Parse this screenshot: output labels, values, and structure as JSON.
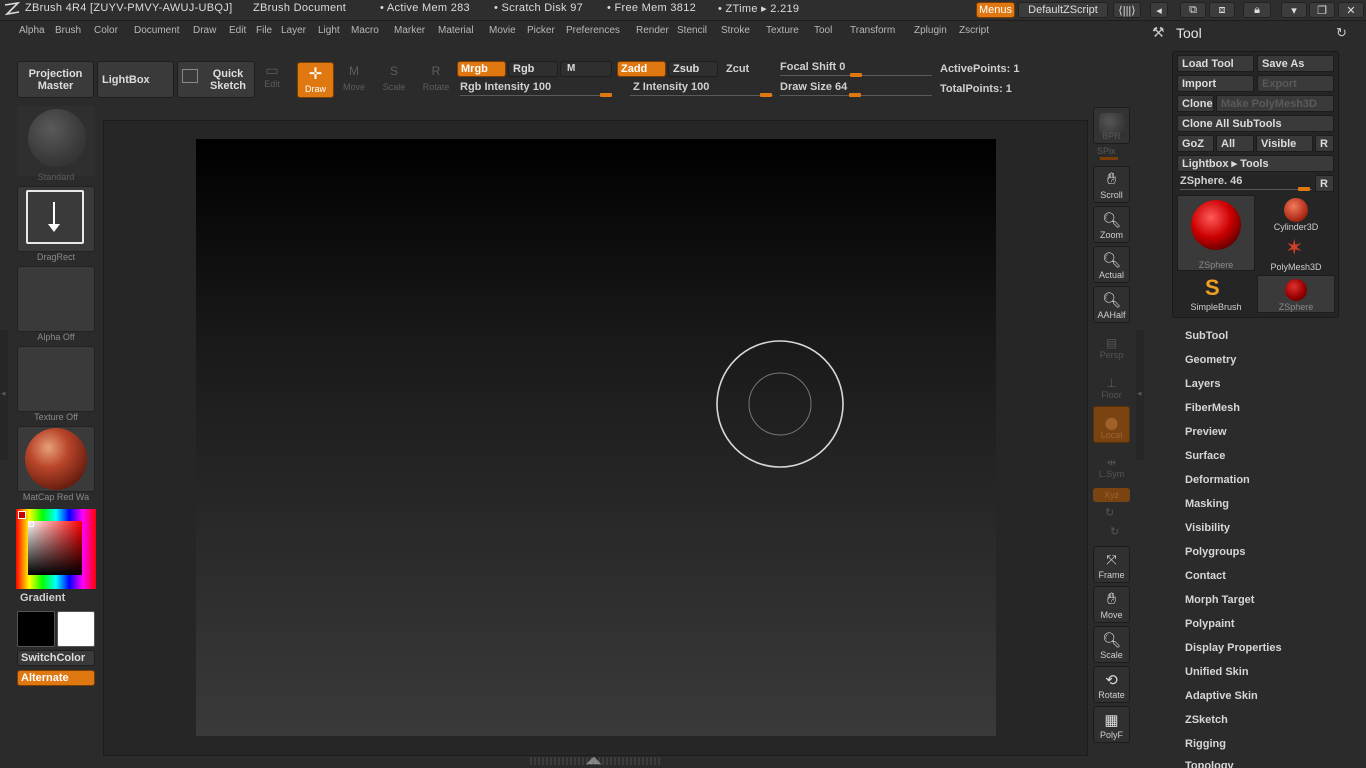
{
  "titlebar": {
    "app": "ZBrush 4R4 [ZUYV-PMVY-AWUJ-UBQJ]",
    "document": "ZBrush Document",
    "active_mem": "• Active Mem 283",
    "scratch": "• Scratch Disk 97",
    "free_mem": "• Free Mem 3812",
    "ztime": "• ZTime ▸ 2.219",
    "menus_btn": "Menus",
    "script_btn": "DefaultZScript"
  },
  "menubar": [
    "Alpha",
    "Brush",
    "Color",
    "Document",
    "Draw",
    "Edit",
    "File",
    "Layer",
    "Light",
    "Macro",
    "Marker",
    "Material",
    "Movie",
    "Picker",
    "Preferences",
    "Render",
    "Stencil",
    "Stroke",
    "Texture",
    "Tool",
    "Transform",
    "Zplugin",
    "Zscript"
  ],
  "shelf": {
    "projection_master": "Projection Master",
    "lightbox": "LightBox",
    "quick_sketch": "Quick Sketch",
    "edit": "Edit",
    "draw": "Draw",
    "move": "Move",
    "scale": "Scale",
    "rotate": "Rotate",
    "mrgb": "Mrgb",
    "rgb": "Rgb",
    "m": "M",
    "zadd": "Zadd",
    "zsub": "Zsub",
    "zcut": "Zcut",
    "rgb_intensity": "Rgb Intensity 100",
    "z_intensity": "Z Intensity 100",
    "focal_shift": "Focal Shift 0",
    "draw_size": "Draw Size 64",
    "active_points": "ActivePoints: 1",
    "total_points": "TotalPoints: 1"
  },
  "left": {
    "brush": "Standard",
    "stroke": "DragRect",
    "alpha": "Alpha Off",
    "texture": "Texture Off",
    "material": "MatCap Red Wa",
    "gradient": "Gradient",
    "switch_color": "SwitchColor",
    "alternate": "Alternate"
  },
  "righttools": [
    "BPR",
    "SPix",
    "Scroll",
    "Zoom",
    "Actual",
    "AAHalf",
    "Persp",
    "Floor",
    "Local",
    "L.Sym",
    "Xyz",
    "Frame",
    "Move",
    "Scale",
    "Rotate",
    "PolyF"
  ],
  "tool": {
    "title": "Tool",
    "load_tool": "Load Tool",
    "save_as": "Save As",
    "import": "Import",
    "export": "Export",
    "clone": "Clone",
    "make_polymesh": "Make PolyMesh3D",
    "clone_all": "Clone All SubTools",
    "goz": "GoZ",
    "all": "All",
    "visible": "Visible",
    "r": "R",
    "lightbox_tools": "Lightbox ▸ Tools",
    "zsphere_slider": "ZSphere. 46",
    "thumbs": [
      "ZSphere",
      "Cylinder3D",
      "PolyMesh3D",
      "SimpleBrush",
      "ZSphere"
    ],
    "sections": [
      "SubTool",
      "Geometry",
      "Layers",
      "FiberMesh",
      "Preview",
      "Surface",
      "Deformation",
      "Masking",
      "Visibility",
      "Polygroups",
      "Contact",
      "Morph Target",
      "Polypaint",
      "Display Properties",
      "Unified Skin",
      "Adaptive Skin",
      "ZSketch",
      "Rigging",
      "Topology"
    ]
  },
  "colors": {
    "accent": "#e07812",
    "bg": "#2b2b2b"
  }
}
